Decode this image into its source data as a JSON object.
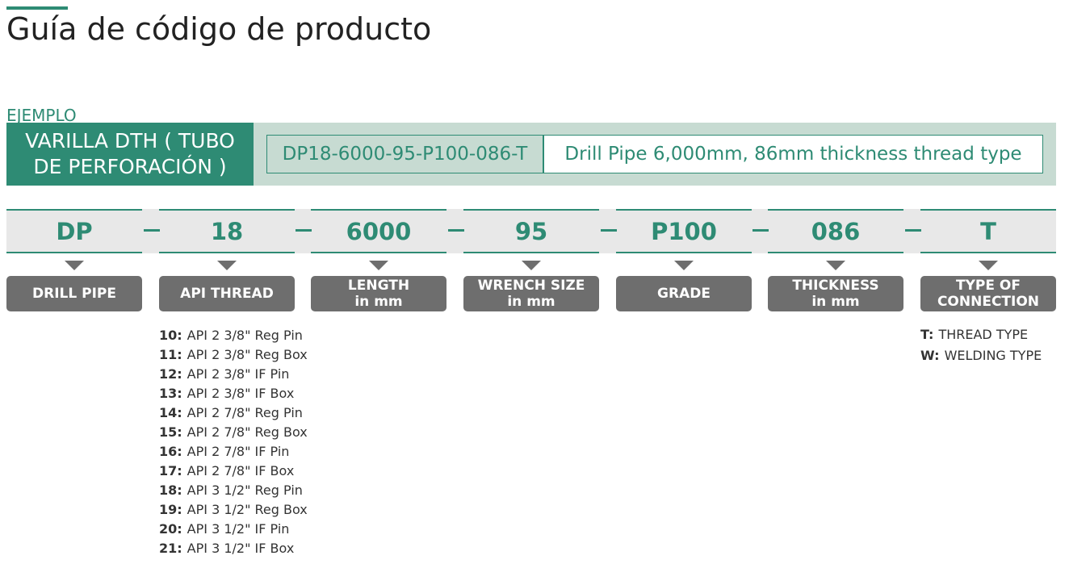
{
  "title": "Guía de código de producto",
  "example": {
    "label": "EJEMPLO",
    "name": "VARILLA DTH ( TUBO DE PERFORACIÓN )",
    "code": "DP18-6000-95-P100-086-T",
    "description": "Drill Pipe 6,000mm, 86mm thickness thread type"
  },
  "segments": [
    {
      "code": "DP",
      "label_line1": "DRILL PIPE",
      "label_line2": ""
    },
    {
      "code": "18",
      "label_line1": "API THREAD",
      "label_line2": ""
    },
    {
      "code": "6000",
      "label_line1": "LENGTH",
      "label_line2": "in mm"
    },
    {
      "code": "95",
      "label_line1": "WRENCH SIZE",
      "label_line2": "in mm"
    },
    {
      "code": "P100",
      "label_line1": "GRADE",
      "label_line2": ""
    },
    {
      "code": "086",
      "label_line1": "THICKNESS",
      "label_line2": "in mm"
    },
    {
      "code": "T",
      "label_line1": "TYPE OF",
      "label_line2": "CONNECTION"
    }
  ],
  "separator": "—",
  "api_threads": [
    {
      "key": "10:",
      "value": "API 2 3/8\" Reg Pin"
    },
    {
      "key": "11:",
      "value": "API 2 3/8\" Reg Box"
    },
    {
      "key": "12:",
      "value": "API 2 3/8\" IF Pin"
    },
    {
      "key": "13:",
      "value": "API 2 3/8\" IF Box"
    },
    {
      "key": "14:",
      "value": "API 2 7/8\" Reg Pin"
    },
    {
      "key": "15:",
      "value": "API 2 7/8\" Reg Box"
    },
    {
      "key": "16:",
      "value": "API 2 7/8\" IF Pin"
    },
    {
      "key": "17:",
      "value": "API 2 7/8\" IF Box"
    },
    {
      "key": "18:",
      "value": "API 3 1/2\" Reg Pin"
    },
    {
      "key": "19:",
      "value": "API 3 1/2\" Reg Box"
    },
    {
      "key": "20:",
      "value": "API 3 1/2\" IF Pin"
    },
    {
      "key": "21:",
      "value": "API 3 1/2\" IF Box"
    }
  ],
  "connection_types": [
    {
      "key": "T:",
      "value": "THREAD TYPE"
    },
    {
      "key": "W:",
      "value": "WELDING TYPE"
    }
  ],
  "colors": {
    "accent": "#2e8b74",
    "label_bg": "#6e6e6e",
    "band_bg": "#e8e8e8",
    "example_bg": "#c7dbd2"
  }
}
